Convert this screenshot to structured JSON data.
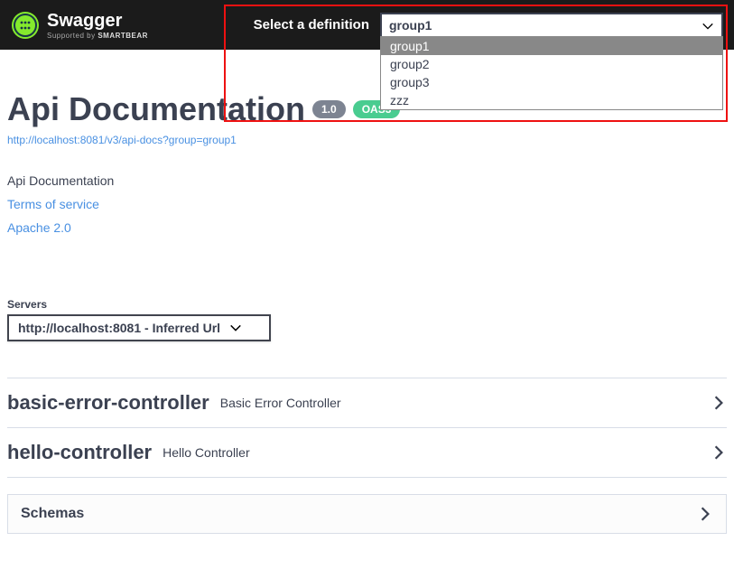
{
  "brand": {
    "name": "Swagger",
    "supported_prefix": "Supported by ",
    "supported_brand": "SMARTBEAR"
  },
  "definition": {
    "label": "Select a definition",
    "selected": "group1",
    "options": [
      "group1",
      "group2",
      "group3",
      "zzz"
    ]
  },
  "info": {
    "title": "Api Documentation",
    "version": "1.0",
    "oas_label": "OAS3",
    "url": "http://localhost:8081/v3/api-docs?group=group1",
    "description": "Api Documentation",
    "terms_link": "Terms of service",
    "license": "Apache 2.0"
  },
  "servers": {
    "label": "Servers",
    "selected": "http://localhost:8081 - Inferred Url"
  },
  "tags": [
    {
      "name": "basic-error-controller",
      "desc": "Basic Error Controller"
    },
    {
      "name": "hello-controller",
      "desc": "Hello Controller"
    }
  ],
  "schemas": {
    "title": "Schemas"
  }
}
